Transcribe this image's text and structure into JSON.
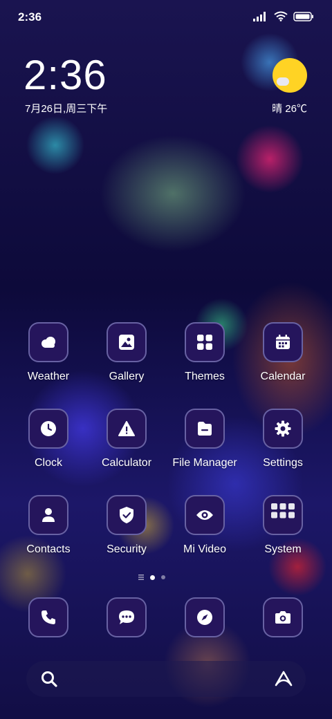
{
  "status_bar": {
    "time": "2:36",
    "icons": [
      "signal-icon",
      "wifi-icon",
      "battery-icon"
    ]
  },
  "clock_widget": {
    "time": "2:36",
    "date": "7月26日,周三下午"
  },
  "weather_widget": {
    "condition_icon": "sunny-partly-cloudy-icon",
    "text": "晴 26℃"
  },
  "apps": [
    {
      "label": "Weather",
      "icon": "weather-icon"
    },
    {
      "label": "Gallery",
      "icon": "gallery-icon"
    },
    {
      "label": "Themes",
      "icon": "themes-icon"
    },
    {
      "label": "Calendar",
      "icon": "calendar-icon"
    },
    {
      "label": "Clock",
      "icon": "clock-icon"
    },
    {
      "label": "Calculator",
      "icon": "calculator-icon"
    },
    {
      "label": "File Manager",
      "icon": "file-manager-icon"
    },
    {
      "label": "Settings",
      "icon": "settings-icon"
    },
    {
      "label": "Contacts",
      "icon": "contacts-icon"
    },
    {
      "label": "Security",
      "icon": "security-icon"
    },
    {
      "label": "Mi Video",
      "icon": "mi-video-icon"
    },
    {
      "label": "System",
      "icon": "system-folder-icon"
    }
  ],
  "dock": [
    {
      "icon": "phone-icon"
    },
    {
      "icon": "messages-icon"
    },
    {
      "icon": "browser-icon"
    },
    {
      "icon": "camera-icon"
    }
  ],
  "search_bar": {
    "left_icon": "search-icon",
    "right_icon": "assistant-icon"
  },
  "colors": {
    "tile_background": "#25155c",
    "sun": "#ffd324"
  }
}
